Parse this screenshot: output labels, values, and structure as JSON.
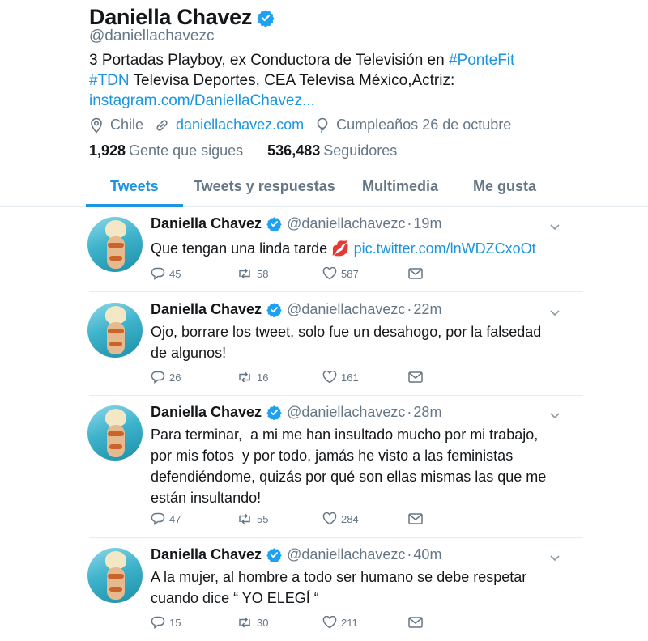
{
  "profile": {
    "name": "Daniella Chavez",
    "handle": "@daniellachavezc",
    "bio_part1": "3 Portadas Playboy, ex Conductora de Televisión en ",
    "bio_hashtag1": "#PonteFit",
    "bio_hashtag2": "#TDN",
    "bio_part2": " Televisa Deportes, CEA Televisa México,Actriz:",
    "bio_link": "instagram.com/DaniellaChavez...",
    "location": "Chile",
    "website": "daniellachavez.com",
    "birthday": "Cumpleaños 26 de octubre",
    "following_count": "1,928",
    "following_label": "Gente que sigues",
    "followers_count": "536,483",
    "followers_label": "Seguidores"
  },
  "tabs": [
    {
      "label": "Tweets",
      "active": true
    },
    {
      "label": "Tweets y respuestas",
      "active": false
    },
    {
      "label": "Multimedia",
      "active": false
    },
    {
      "label": "Me gusta",
      "active": false
    }
  ],
  "tweets": [
    {
      "name": "Daniella Chavez",
      "handle": "@daniellachavezc",
      "dot": "·",
      "time": "19m",
      "text_before": "Que tengan una linda tarde ",
      "emoji": "💋",
      "link": "pic.twitter.com/lnWDZCxoOt",
      "replies": "45",
      "retweets": "58",
      "likes": "587"
    },
    {
      "name": "Daniella Chavez",
      "handle": "@daniellachavezc",
      "dot": "·",
      "time": "22m",
      "text": "Ojo, borrare los tweet, solo fue un desahogo, por la falsedad de algunos!",
      "replies": "26",
      "retweets": "16",
      "likes": "161"
    },
    {
      "name": "Daniella Chavez",
      "handle": "@daniellachavezc",
      "dot": "·",
      "time": "28m",
      "text": "Para terminar,  a mi me han insultado mucho por mi trabajo, por mis fotos  y por todo, jamás he visto a las feministas defendiéndome, quizás por qué son ellas mismas las que me están insultando!",
      "replies": "47",
      "retweets": "55",
      "likes": "284"
    },
    {
      "name": "Daniella Chavez",
      "handle": "@daniellachavezc",
      "dot": "·",
      "time": "40m",
      "text": "A la mujer, al hombre a todo ser humano se debe respetar cuando dice “ YO ELEGÍ “",
      "replies": "15",
      "retweets": "30",
      "likes": "211"
    }
  ],
  "colors": {
    "accent": "#1b95e0",
    "verified": "#1da1f2",
    "muted": "#657786",
    "text": "#14171a",
    "emoji": "#e0245e"
  },
  "icons": {
    "location": "location-pin-icon",
    "website": "link-icon",
    "birthday": "balloon-icon",
    "reply": "reply-icon",
    "retweet": "retweet-icon",
    "like": "heart-icon",
    "message": "envelope-icon",
    "verified": "verified-badge-icon",
    "caret": "chevron-down-icon"
  }
}
